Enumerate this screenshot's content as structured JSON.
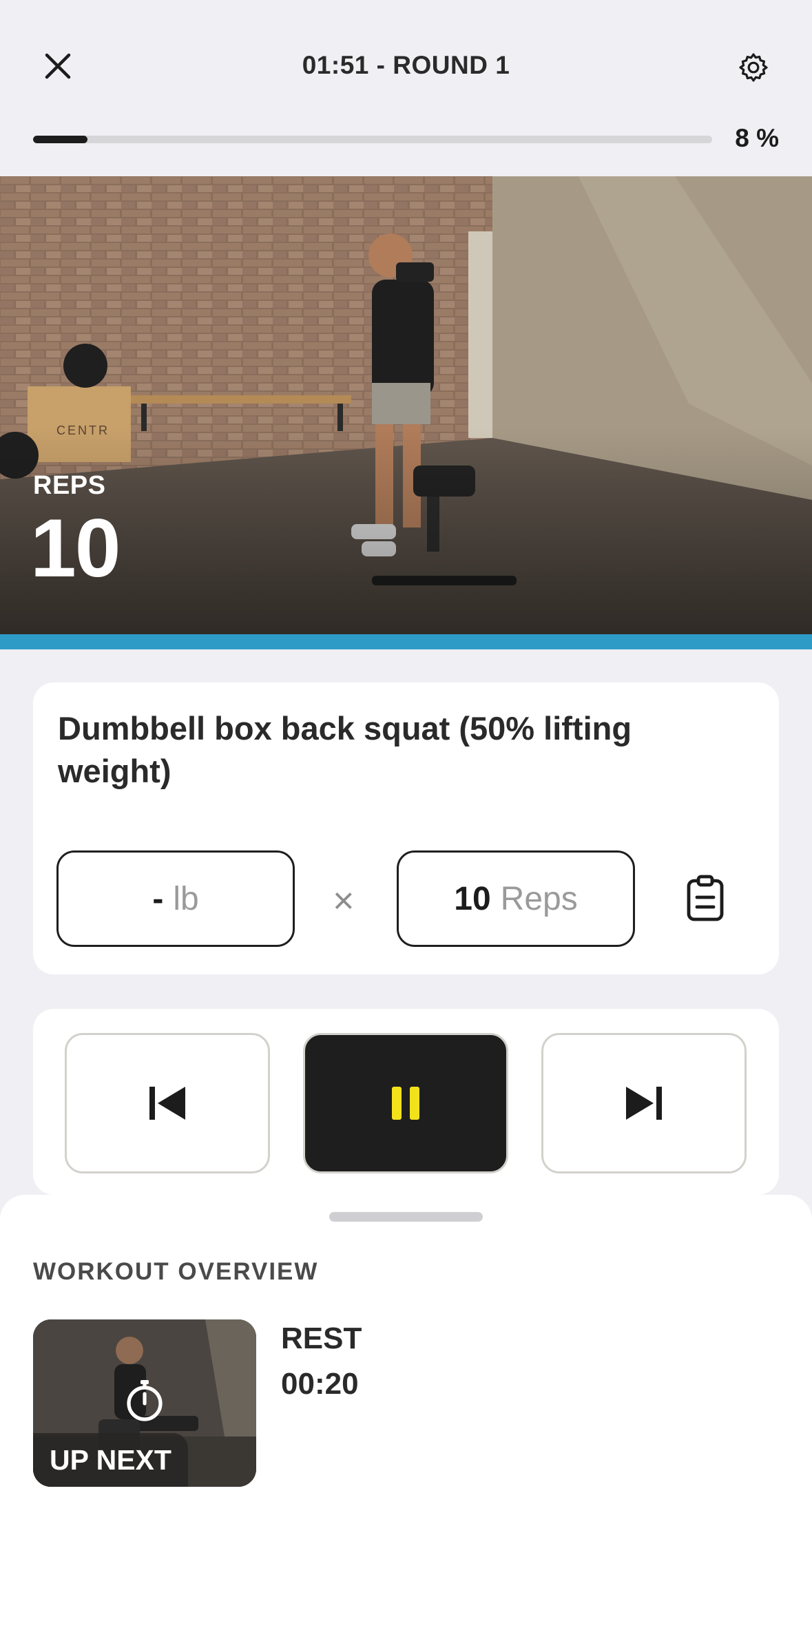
{
  "header": {
    "title": "01:51 - ROUND 1",
    "progress_percent": 8,
    "progress_label": "8 %",
    "close_icon": "close-icon",
    "settings_icon": "gear-icon"
  },
  "video": {
    "reps_label": "REPS",
    "reps_value": "10",
    "accent_color": "#2e9bc7"
  },
  "exercise": {
    "name": "Dumbbell box back squat (50% lifting weight)",
    "weight_value": "-",
    "weight_unit": "lb",
    "times_symbol": "×",
    "reps_value": "10",
    "reps_unit": "Reps",
    "log_icon": "clipboard-icon"
  },
  "controls": {
    "prev_icon": "skip-previous-icon",
    "pause_icon": "pause-icon",
    "next_icon": "skip-next-icon",
    "pause_color": "#f2e21b"
  },
  "overview": {
    "title": "WORKOUT OVERVIEW",
    "up_next_label": "UP NEXT",
    "next_name": "REST",
    "next_duration": "00:20"
  }
}
